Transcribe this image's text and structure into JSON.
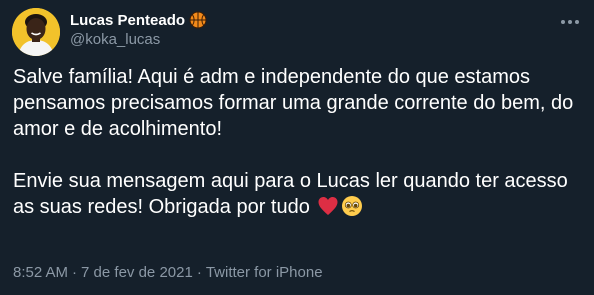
{
  "user": {
    "display_name": "Lucas Penteado",
    "handle": "@koka_lucas",
    "badge_icon": "basketball-icon",
    "avatar_bg": "#f2c22b"
  },
  "tweet": {
    "paragraph1": "Salve família! Aqui é adm e independente do que estamos pensamos precisamos formar uma grande corrente do bem, do amor e de acolhimento!",
    "paragraph2": "Envie sua mensagem aqui para o Lucas ler quando ter acesso as suas redes! Obrigada por tudo",
    "emojis": [
      "red-heart-emoji",
      "pleading-face-emoji"
    ]
  },
  "meta": {
    "time": "8:52 AM",
    "separator1": "·",
    "date": "7 de fev de 2021",
    "separator2": "·",
    "source": "Twitter for iPhone"
  },
  "colors": {
    "background": "#15202b",
    "text_primary": "#ffffff",
    "text_secondary": "#8b98a5"
  }
}
